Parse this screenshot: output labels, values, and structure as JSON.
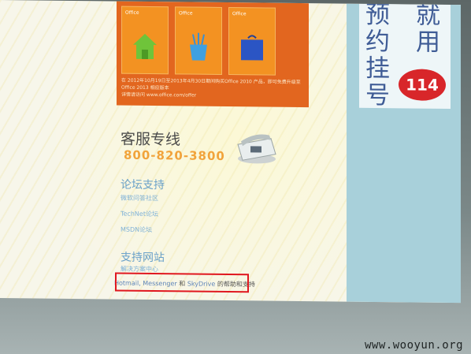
{
  "ad": {
    "chars": [
      "预",
      "就",
      "约",
      "用",
      "挂",
      "号"
    ],
    "badge": "114"
  },
  "banner": {
    "products": [
      {
        "caption": "Office"
      },
      {
        "caption": "Office"
      },
      {
        "caption": "Office"
      }
    ],
    "text": "在 2012年10月19日至2013年4月30日期间购买Office 2010 产品，即可免费升级至 Office 2013 相应版本",
    "url": "详情请访问 www.office.com/offer"
  },
  "support": {
    "hotline_title": "客服专线",
    "hotline_number": "800-820-3800",
    "forum_title": "论坛支持",
    "forum_links": [
      "微软问答社区",
      "TechNet论坛",
      "MSDN论坛"
    ],
    "site_title": "支持网站",
    "site_links": [
      "解决方案中心"
    ],
    "line": {
      "link1": "Hotmail, Messenger",
      "and": "和",
      "link2": "SkyDrive",
      "suffix": "的帮助和支持"
    }
  },
  "watermark": "www.wooyun.org",
  "colors": {
    "banner": "#e2661f",
    "highlight": "#e0171f",
    "link": "#7db0d6",
    "hotline": "#f1a33b"
  }
}
